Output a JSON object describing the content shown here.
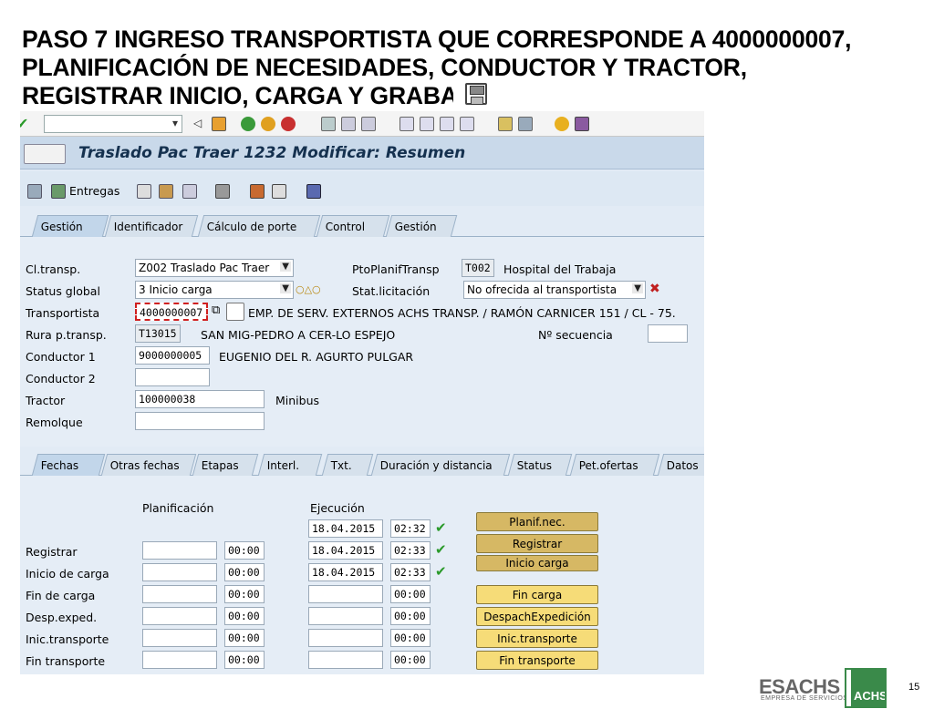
{
  "slide": {
    "title_lines": [
      "PASO 7 INGRESO TRANSPORTISTA QUE  CORRESPONDE A 4000000007,",
      "PLANIFICACIÓN DE NECESIDADES, CONDUCTOR Y TRACTOR,",
      "REGISTRAR INICIO, CARGA Y GRABAR"
    ],
    "page_number": "15",
    "logo": {
      "name": "ESACHS",
      "sub": "EMPRESA DE SERVICIOS",
      "badge": "ACHS",
      "color": "#3a8a4a"
    }
  },
  "window": {
    "title": "Traslado Pac Traer 1232 Modificar: Resumen",
    "toolbar": {
      "entregas_label": "Entregas"
    }
  },
  "header_tabs": [
    "Gestión",
    "Identificador",
    "Cálculo de porte",
    "Control",
    "Gestión"
  ],
  "form": {
    "cl_transp": {
      "label": "Cl.transp.",
      "value": "Z002 Traslado Pac Traer"
    },
    "status_global": {
      "label": "Status global",
      "value": "3 Inicio carga"
    },
    "transportista": {
      "label": "Transportista",
      "value": "4000000007",
      "desc": "EMP. DE SERV. EXTERNOS ACHS TRANSP. / RAMÓN CARNICER 151 / CL - 75..."
    },
    "ruta": {
      "label": "Rura p.transp.",
      "value": "T13015",
      "desc": "SAN MIG-PEDRO A CER-LO ESPEJO"
    },
    "conductor1": {
      "label": "Conductor 1",
      "value": "9000000005",
      "desc": "EUGENIO DEL R. AGURTO PULGAR"
    },
    "conductor2": {
      "label": "Conductor 2",
      "value": ""
    },
    "tractor": {
      "label": "Tractor",
      "value": "100000038",
      "desc": "Minibus"
    },
    "remolque": {
      "label": "Remolque",
      "value": ""
    },
    "pto_planif": {
      "label": "PtoPlanifTransp",
      "value": "T002",
      "desc": "Hospital del Trabaja"
    },
    "stat_licitacion": {
      "label": "Stat.licitación",
      "value": "No ofrecida al transportista"
    },
    "nro_secuencia": {
      "label": "Nº secuencia",
      "value": ""
    }
  },
  "detail_tabs": [
    "Fechas",
    "Otras fechas",
    "Etapas",
    "Interl.",
    "Txt.",
    "Duración y distancia",
    "Status",
    "Pet.ofertas",
    "Datos"
  ],
  "fechas": {
    "col_planificacion": "Planificación",
    "col_ejecucion": "Ejecución",
    "top_exec": {
      "date": "18.04.2015",
      "time": "02:32"
    },
    "rows": [
      {
        "label": "Registrar",
        "plan_time": "00:00",
        "exec_date": "18.04.2015",
        "exec_time": "02:33",
        "checked": true
      },
      {
        "label": "Inicio de carga",
        "plan_time": "00:00",
        "exec_date": "18.04.2015",
        "exec_time": "02:33",
        "checked": true
      },
      {
        "label": "Fin de carga",
        "plan_time": "00:00",
        "exec_date": "",
        "exec_time": "00:00",
        "checked": false
      },
      {
        "label": "Desp.exped.",
        "plan_time": "00:00",
        "exec_date": "",
        "exec_time": "00:00",
        "checked": false
      },
      {
        "label": "Inic.transporte",
        "plan_time": "00:00",
        "exec_date": "",
        "exec_time": "00:00",
        "checked": false
      },
      {
        "label": "Fin transporte",
        "plan_time": "00:00",
        "exec_date": "",
        "exec_time": "00:00",
        "checked": false
      }
    ],
    "buttons": [
      "Planif.nec.",
      "Registrar",
      "Inicio carga",
      "Fin carga",
      "DespachExpedición",
      "Inic.transporte",
      "Fin transporte"
    ]
  }
}
